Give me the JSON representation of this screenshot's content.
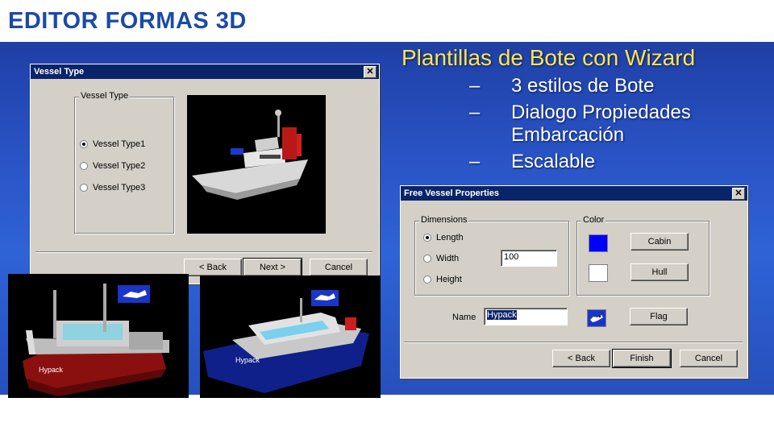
{
  "slide": {
    "title": "EDITOR FORMAS 3D",
    "heading": "Plantillas de Bote con Wizard",
    "bullets": [
      {
        "dash": "–",
        "text": "3 estilos de Bote"
      },
      {
        "dash": "–",
        "text": "Dialogo Propiedades Embarcación"
      },
      {
        "dash": "–",
        "text": "Escalable"
      }
    ]
  },
  "vessel_dialog": {
    "title": "Vessel Type",
    "close_label": "✕",
    "group_label": "Vessel Type",
    "options": [
      "Vessel Type1",
      "Vessel Type2",
      "Vessel Type3"
    ],
    "selected_index": 0,
    "back_label": "< Back",
    "next_label": "Next >",
    "cancel_label": "Cancel"
  },
  "properties_dialog": {
    "title": "Free Vessel Properties",
    "close_label": "✕",
    "dimensions_label": "Dimensions",
    "dimension_options": [
      "Length",
      "Width",
      "Height"
    ],
    "selected_dimension": 0,
    "dimension_value": "100",
    "color_label": "Color",
    "cabin_color": "#0000ff",
    "hull_color": "#ffffff",
    "cabin_label": "Cabin",
    "hull_label": "Hull",
    "name_label": "Name",
    "name_value": "Hypack",
    "flag_label": "Flag",
    "back_label": "< Back",
    "finish_label": "Finish",
    "cancel_label": "Cancel"
  },
  "boat_labels": {
    "red_boat_name": "Hypack",
    "blue_boat_name": "Hypack"
  },
  "colors": {
    "title_blue": "#1a4aa8",
    "heading_yellow": "#ffe64a",
    "titlebar": "#0a246a",
    "dialog_face": "#d4d0c8"
  }
}
